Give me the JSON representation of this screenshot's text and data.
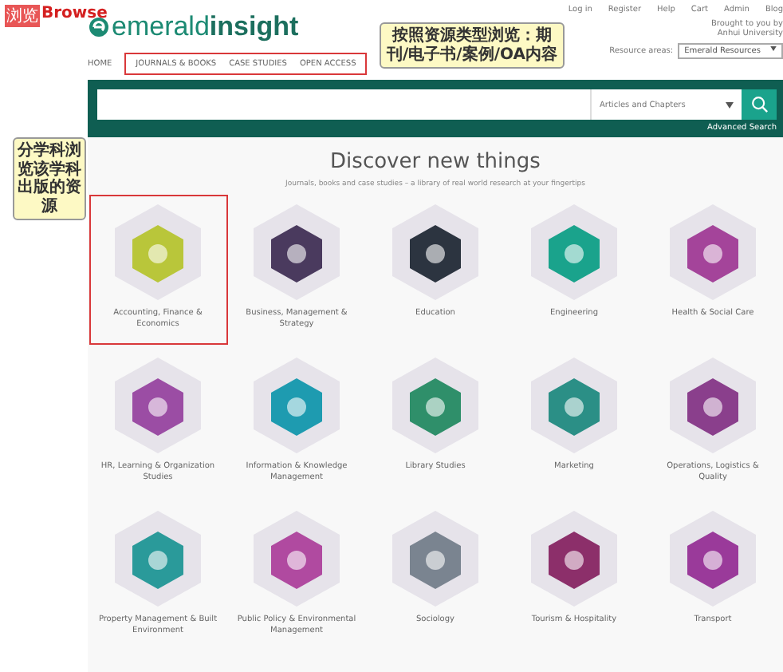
{
  "annotations": [
    {
      "kind": "tag",
      "label": "浏览",
      "text": "Browse"
    },
    {
      "kind": "callout",
      "text": "按照资源类型浏览：期刊/电子书/案例/OA内容"
    },
    {
      "kind": "side_callout",
      "text": "分学科浏览该学科出版的资源"
    }
  ],
  "header": {
    "logo_prefix": "emerald",
    "logo_suffix": "insight",
    "nav": [
      {
        "label": "HOME",
        "highlighted": false
      },
      {
        "label": "JOURNALS & BOOKS",
        "highlighted": true
      },
      {
        "label": "CASE STUDIES",
        "highlighted": true
      },
      {
        "label": "OPEN ACCESS",
        "highlighted": true
      }
    ],
    "top_links": [
      "Log in",
      "Register",
      "Help",
      "Cart",
      "Admin",
      "Blog"
    ],
    "brought_by": [
      "Brought to you by",
      "Anhui University"
    ],
    "resource_label": "Resource areas:",
    "resource_value": "Emerald Resources"
  },
  "search": {
    "scope": "Articles and Chapters",
    "advanced": "Advanced Search"
  },
  "discover": {
    "title": "Discover new things",
    "subtitle": "Journals, books and case studies – a library of real world research at your fingertips",
    "categories": [
      {
        "label": "Accounting, Finance & Economics",
        "highlighted": true,
        "color": "#b9c63a"
      },
      {
        "label": "Business, Management & Strategy",
        "highlighted": false,
        "color": "#4a3a5e"
      },
      {
        "label": "Education",
        "highlighted": false,
        "color": "#2c3440"
      },
      {
        "label": "Engineering",
        "highlighted": false,
        "color": "#1aa38c"
      },
      {
        "label": "Health & Social Care",
        "highlighted": false,
        "color": "#a4449a"
      },
      {
        "label": "HR, Learning & Organization Studies",
        "highlighted": false,
        "color": "#9b4da4"
      },
      {
        "label": "Information & Knowledge Management",
        "highlighted": false,
        "color": "#1e9bb0"
      },
      {
        "label": "Library Studies",
        "highlighted": false,
        "color": "#2f8f6a"
      },
      {
        "label": "Marketing",
        "highlighted": false,
        "color": "#2b8f86"
      },
      {
        "label": "Operations, Logistics & Quality",
        "highlighted": false,
        "color": "#8a3f8c"
      },
      {
        "label": "Property Management & Built Environment",
        "highlighted": false,
        "color": "#2a9a9a"
      },
      {
        "label": "Public Policy & Environmental Management",
        "highlighted": false,
        "color": "#b04aa0"
      },
      {
        "label": "Sociology",
        "highlighted": false,
        "color": "#7a8490"
      },
      {
        "label": "Tourism & Hospitality",
        "highlighted": false,
        "color": "#8c2f6a"
      },
      {
        "label": "Transport",
        "highlighted": false,
        "color": "#9a3a9a"
      }
    ]
  }
}
